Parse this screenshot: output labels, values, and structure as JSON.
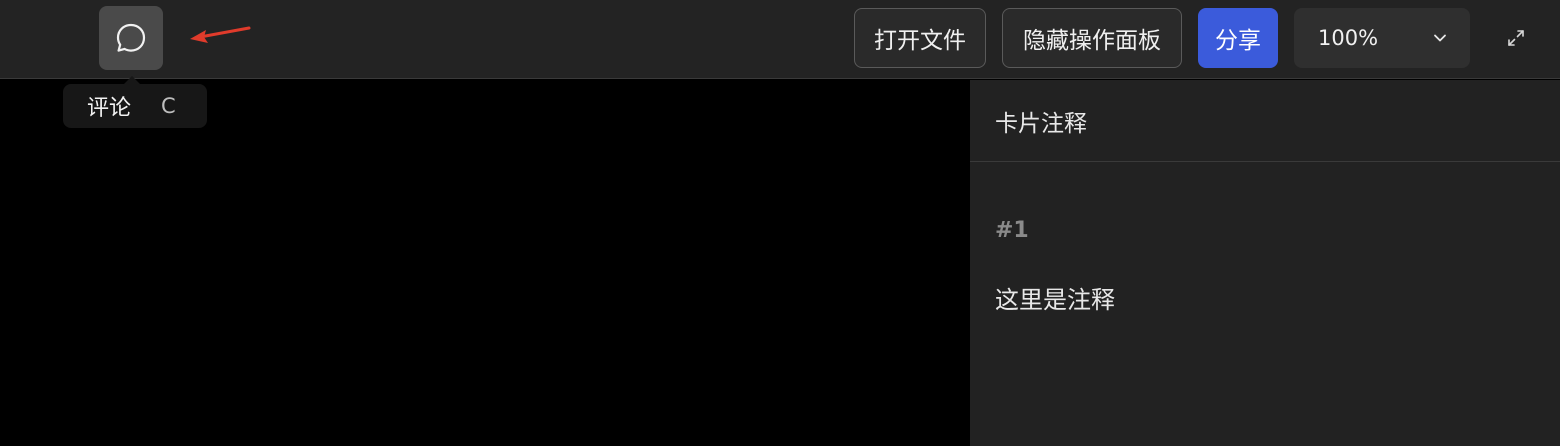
{
  "toolbar": {
    "comment_tooltip_label": "评论",
    "comment_tooltip_shortcut": "C",
    "open_file_label": "打开文件",
    "hide_panel_label": "隐藏操作面板",
    "share_label": "分享",
    "zoom_value": "100%"
  },
  "panel": {
    "title": "卡片注释",
    "note_number": "#1",
    "note_text": "这里是注释"
  },
  "icons": {
    "comment": "comment-bubble-icon",
    "arrow": "red-pointer-arrow",
    "zoom_dropdown": "chevron-down-icon",
    "fullscreen": "expand-icon"
  },
  "colors": {
    "share_accent": "#3b5bdb",
    "arrow": "#e03b2b"
  }
}
